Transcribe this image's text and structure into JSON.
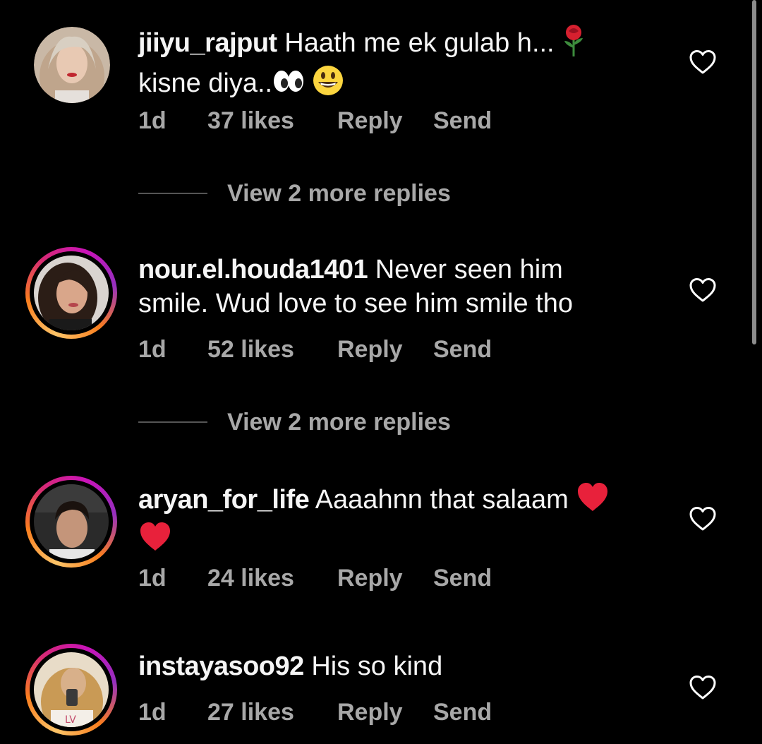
{
  "comments": [
    {
      "username": "jiiyu_rajput",
      "text": " Haath me ek gulab h...",
      "text_line2": "kisne diya..",
      "emojis": [
        "rose",
        "eyes",
        "grinning-face"
      ],
      "age": "1d",
      "likes": "37 likes",
      "reply_label": "Reply",
      "send_label": "Send",
      "view_replies": "View 2 more replies",
      "has_story_ring": false
    },
    {
      "username": "nour.el.houda1401",
      "text": " Never seen him",
      "text_line2": "smile. Wud love to see him smile tho",
      "emojis": [],
      "age": "1d",
      "likes": "52 likes",
      "reply_label": "Reply",
      "send_label": "Send",
      "view_replies": "View 2 more replies",
      "has_story_ring": true
    },
    {
      "username": "aryan_for_life",
      "text": " Aaaahnn that salaam",
      "text_line2": "",
      "emojis": [
        "red-heart",
        "red-heart"
      ],
      "age": "1d",
      "likes": "24 likes",
      "reply_label": "Reply",
      "send_label": "Send",
      "has_story_ring": true
    },
    {
      "username": "instayasoo92",
      "text": " His so kind",
      "text_line2": "",
      "emojis": [],
      "age": "1d",
      "likes": "27 likes",
      "reply_label": "Reply",
      "send_label": "Send",
      "has_story_ring": true
    }
  ],
  "icons": {
    "like": "heart-outline-icon",
    "reply_divider": "divider-line"
  },
  "colors": {
    "background": "#000000",
    "primary_text": "#f5f5f5",
    "secondary_text": "#a8a8a8",
    "heart_emoji": "#e8213b",
    "story_ring_start": "#fdc468",
    "story_ring_end": "#c913b9"
  }
}
